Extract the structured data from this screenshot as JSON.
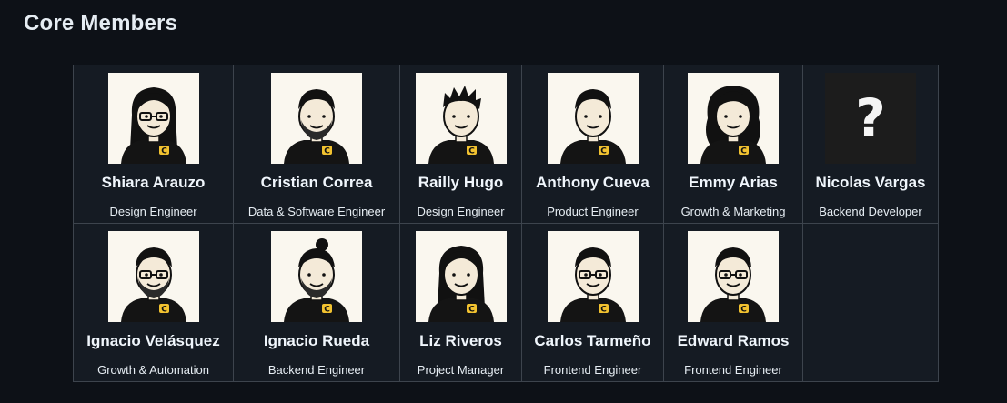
{
  "section": {
    "title": "Core Members"
  },
  "members": [
    {
      "name": "Shiara Arauzo",
      "role": "Design Engineer",
      "hair": "long",
      "glasses": true,
      "beard": false
    },
    {
      "name": "Cristian Correa",
      "role": "Data & Software Engineer",
      "hair": "short",
      "glasses": false,
      "beard": true
    },
    {
      "name": "Railly Hugo",
      "role": "Design Engineer",
      "hair": "spiky",
      "glasses": false,
      "beard": false
    },
    {
      "name": "Anthony Cueva",
      "role": "Product Engineer",
      "hair": "short",
      "glasses": false,
      "beard": false
    },
    {
      "name": "Emmy Arias",
      "role": "Growth & Marketing",
      "hair": "curly",
      "glasses": false,
      "beard": false
    },
    {
      "name": "Nicolas Vargas",
      "role": "Backend Developer",
      "placeholder": "?"
    },
    {
      "name": "Ignacio Velásquez",
      "role": "Growth & Automation",
      "hair": "short",
      "glasses": true,
      "beard": true
    },
    {
      "name": "Ignacio Rueda",
      "role": "Backend Engineer",
      "hair": "bun",
      "glasses": false,
      "beard": true
    },
    {
      "name": "Liz Riveros",
      "role": "Project Manager",
      "hair": "long",
      "glasses": false,
      "beard": false
    },
    {
      "name": "Carlos Tarmeño",
      "role": "Frontend Engineer",
      "hair": "short",
      "glasses": true,
      "beard": false
    },
    {
      "name": "Edward Ramos",
      "role": "Frontend Engineer",
      "hair": "short",
      "glasses": true,
      "beard": false
    }
  ],
  "colors": {
    "background": "#0d1117",
    "grid_cell": "#151b23",
    "grid_border": "#3d444d",
    "avatar_bg": "#faf7ef",
    "shirt": "#141414",
    "logo": "#f2c230"
  },
  "icons": {
    "avatar": "member-avatar-illustration",
    "unknown": "question-mark-icon"
  }
}
